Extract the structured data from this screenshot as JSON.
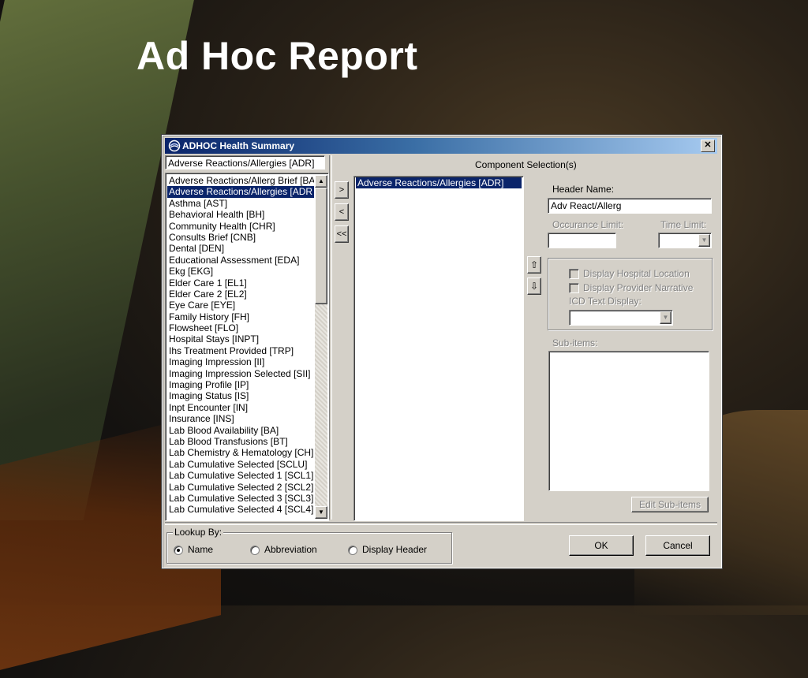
{
  "slide": {
    "title": "Ad Hoc Report"
  },
  "window": {
    "title": "ADHOC Health Summary",
    "close_label": "✕"
  },
  "left": {
    "search_value": "Adverse Reactions/Allergies [ADR]",
    "items": [
      "Adverse Reactions/Allerg Brief [BA",
      "Adverse Reactions/Allergies [ADR",
      "Asthma [AST]",
      "Behavioral Health [BH]",
      "Community Health [CHR]",
      "Consults Brief [CNB]",
      "Dental [DEN]",
      "Educational Assessment [EDA]",
      "Ekg [EKG]",
      "Elder Care 1 [EL1]",
      "Elder Care 2 [EL2]",
      "Eye Care [EYE]",
      "Family History [FH]",
      "Flowsheet [FLO]",
      "Hospital Stays [INPT]",
      "Ihs Treatment Provided [TRP]",
      "Imaging Impression [II]",
      "Imaging Impression Selected [SII]",
      "Imaging Profile [IP]",
      "Imaging Status [IS]",
      "Inpt Encounter [IN]",
      "Insurance [INS]",
      "Lab Blood Availability [BA]",
      "Lab Blood Transfusions [BT]",
      "Lab Chemistry & Hematology [CH]",
      "Lab Cumulative Selected [SCLU]",
      "Lab Cumulative Selected 1 [SCL1]",
      "Lab Cumulative Selected 2 [SCL2]",
      "Lab Cumulative Selected 3 [SCL3]",
      "Lab Cumulative Selected 4 [SCL4]"
    ]
  },
  "middle": {
    "component_label": "Component Selection(s)",
    "add_label": ">",
    "remove_label": "<",
    "remove_all_label": "<<",
    "selected_items": [
      "Adverse Reactions/Allergies [ADR]"
    ],
    "up_label": "⇧",
    "down_label": "⇩"
  },
  "right": {
    "header_name_label": "Header Name:",
    "header_name_value": "Adv React/Allerg",
    "occurance_limit_label": "Occurance Limit:",
    "occurance_limit_value": "",
    "time_limit_label": "Time Limit:",
    "time_limit_value": "",
    "display_hospital_location": "Display Hospital Location",
    "display_provider_narrative": "Display Provider Narrative",
    "icd_text_display_label": "ICD Text Display:",
    "icd_text_display_value": "",
    "sub_items_label": "Sub-items:",
    "edit_sub_items_label": "Edit Sub-items"
  },
  "lookup": {
    "legend": "Lookup By:",
    "options": [
      "Name",
      "Abbreviation",
      "Display Header"
    ],
    "selected": "Name"
  },
  "buttons": {
    "ok": "OK",
    "cancel": "Cancel"
  }
}
